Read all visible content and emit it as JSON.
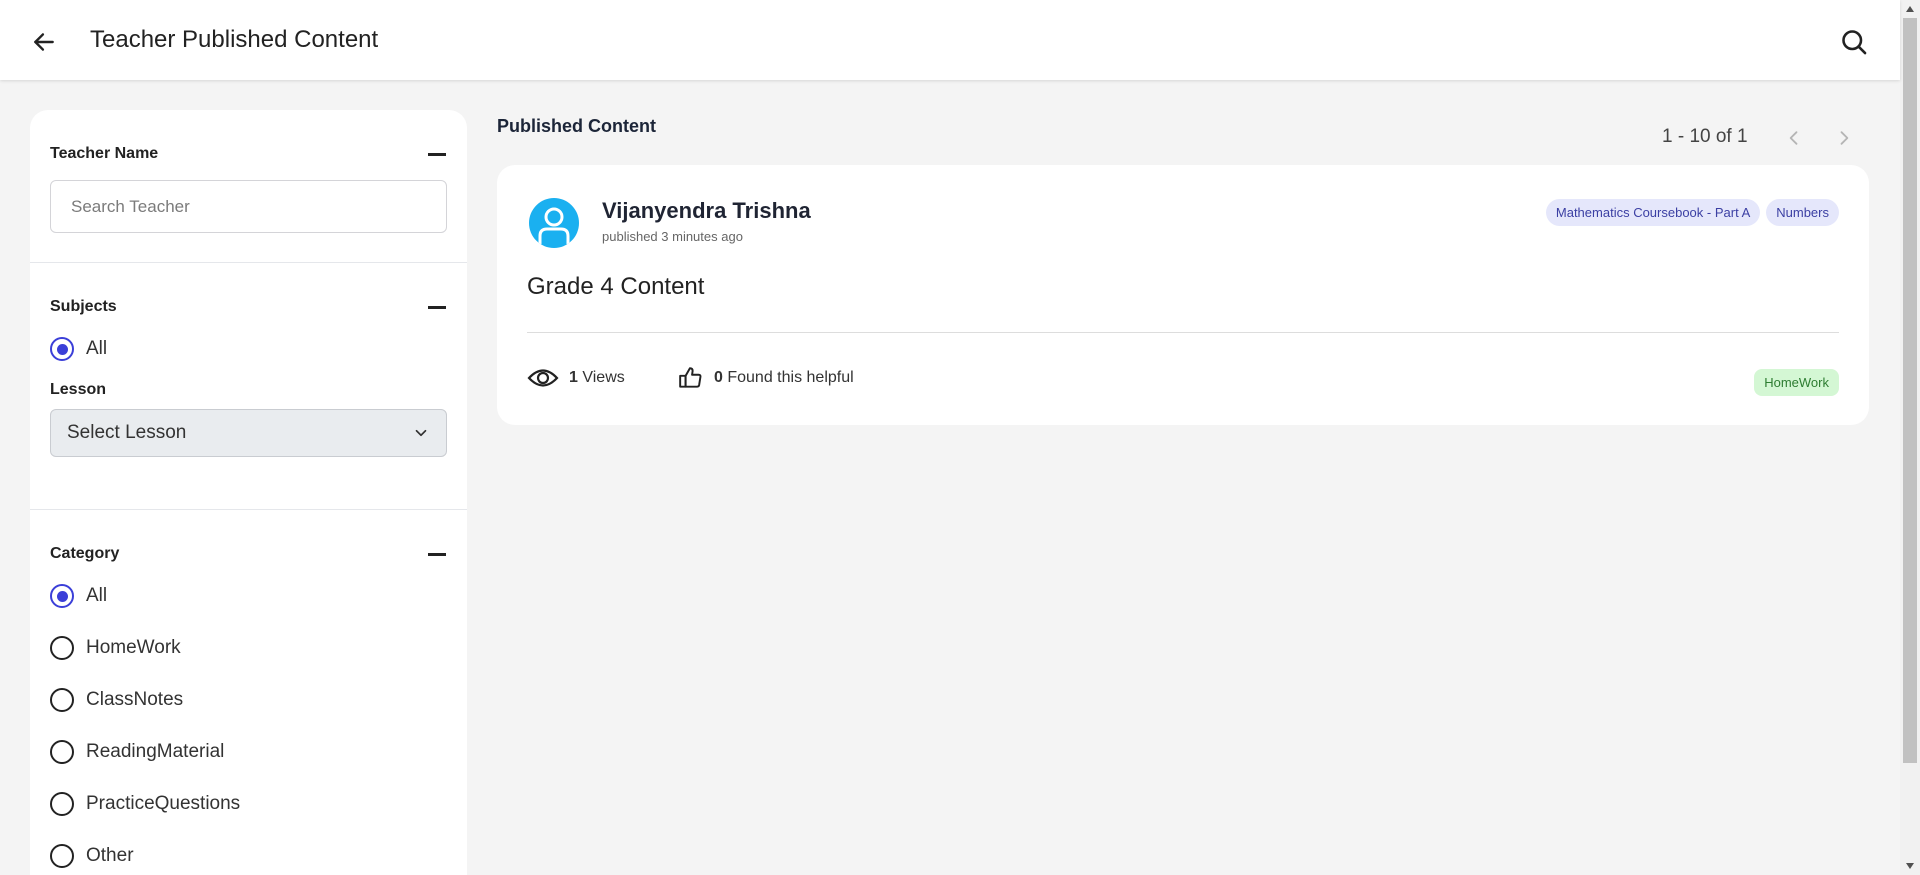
{
  "header": {
    "title": "Teacher Published Content",
    "back_icon": "arrow-left-icon",
    "search_icon": "search-icon"
  },
  "sidebar": {
    "teacher_section": {
      "title": "Teacher Name",
      "search_placeholder": "Search Teacher",
      "search_value": ""
    },
    "subjects_section": {
      "title": "Subjects",
      "options": [
        {
          "label": "All",
          "checked": true
        }
      ],
      "lesson_label": "Lesson",
      "lesson_selected": "Select Lesson"
    },
    "category_section": {
      "title": "Category",
      "options": [
        {
          "label": "All",
          "checked": true
        },
        {
          "label": "HomeWork",
          "checked": false
        },
        {
          "label": "ClassNotes",
          "checked": false
        },
        {
          "label": "ReadingMaterial",
          "checked": false
        },
        {
          "label": "PracticeQuestions",
          "checked": false
        },
        {
          "label": "Other",
          "checked": false
        }
      ]
    }
  },
  "main": {
    "heading": "Published Content",
    "pagination": {
      "text": "1 - 10 of 1"
    },
    "cards": [
      {
        "author": "Vijanyendra Trishna",
        "published": "published 3 minutes ago",
        "tags": [
          "Mathematics Coursebook - Part A",
          "Numbers"
        ],
        "title": "Grade 4 Content",
        "views_count": "1",
        "views_label": "Views",
        "helpful_count": "0",
        "helpful_label": "Found this helpful",
        "type": "HomeWork"
      }
    ]
  },
  "colors": {
    "accent": "#3b3fd8",
    "avatar": "#1ab0f0",
    "tag_bg": "#e5e7fb",
    "homework_badge_bg": "#d4f7d4",
    "homework_badge_text": "#2e7d32"
  }
}
